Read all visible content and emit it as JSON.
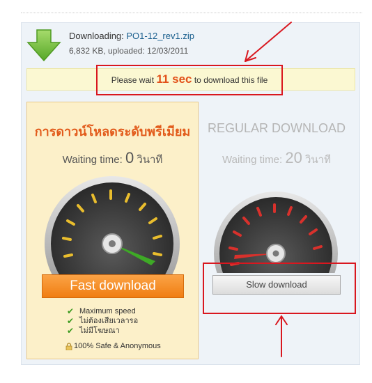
{
  "file": {
    "label": "Downloading: ",
    "name": "PO1-12_rev1.zip",
    "meta": "6,832 KB, uploaded: 12/03/2011"
  },
  "wait_notice": {
    "prefix": "Please wait ",
    "seconds": "11 sec",
    "suffix": " to download this file"
  },
  "premium": {
    "title": "การดาวน์โหลดระดับพรีเมียม",
    "waiting_label": "Waiting time: ",
    "waiting_value": "0",
    "waiting_unit": " วินาที",
    "button_label": "Fast download",
    "features": [
      "Maximum speed",
      "ไม่ต้องเสียเวลารอ",
      "ไม่มีโฆษณา"
    ],
    "safe_label": "100% Safe & Anonymous"
  },
  "regular": {
    "title": "REGULAR DOWNLOAD",
    "waiting_label": "Waiting time: ",
    "waiting_value": "20",
    "waiting_unit": " วินาที",
    "button_label": "Slow download"
  },
  "colors": {
    "accent_orange": "#f07e12",
    "premium_title": "#e25b1b",
    "annotation_red": "#d9171f",
    "download_icon_green": "#7bc043"
  },
  "icons": [
    "download-arrow-icon",
    "speedometer-icon",
    "check-icon",
    "lock-icon"
  ]
}
